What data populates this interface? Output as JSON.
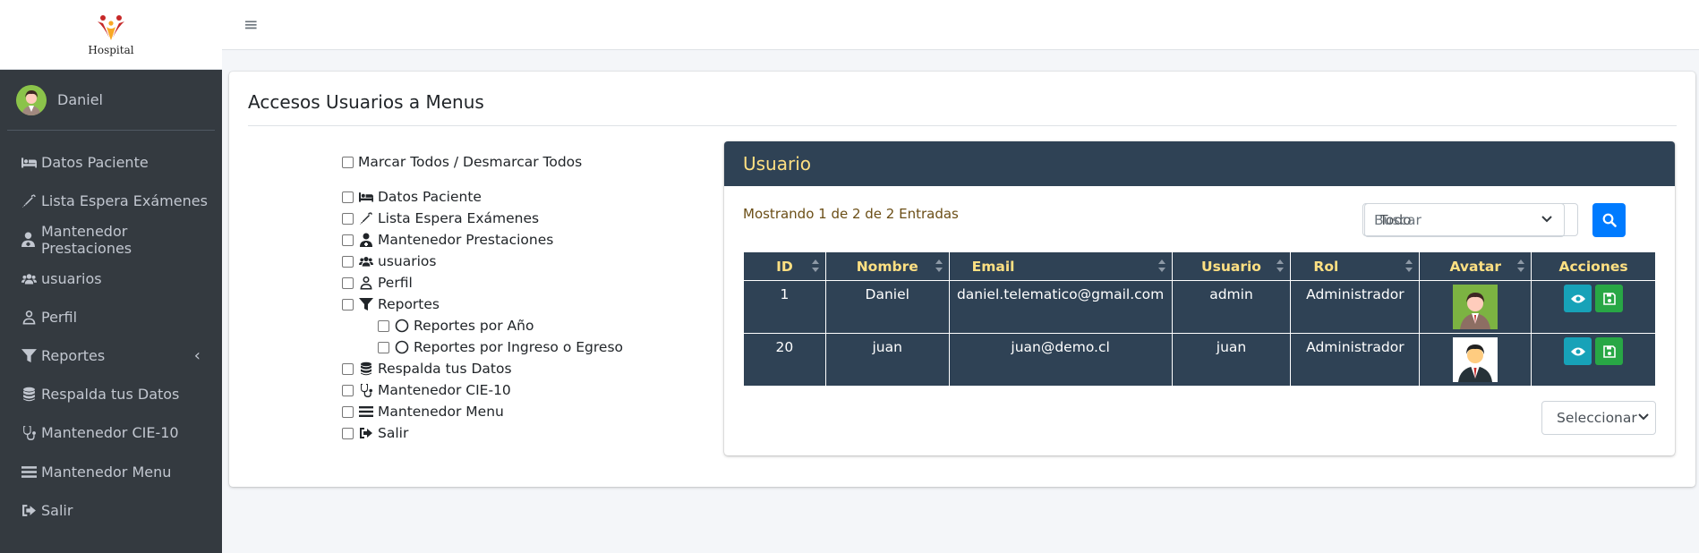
{
  "brand": {
    "name": "Hospital"
  },
  "user": {
    "name": "Daniel"
  },
  "sidebar": {
    "items": [
      {
        "label": "Datos Paciente",
        "icon": "bed-icon"
      },
      {
        "label": "Lista Espera Exámenes",
        "icon": "syringe-icon"
      },
      {
        "label": "Mantenedor Prestaciones",
        "icon": "user-doctor-icon"
      },
      {
        "label": "usuarios",
        "icon": "users-icon"
      },
      {
        "label": "Perfil",
        "icon": "user-icon"
      },
      {
        "label": "Reportes",
        "icon": "filter-icon",
        "has_children": true
      },
      {
        "label": "Respalda tus Datos",
        "icon": "database-icon"
      },
      {
        "label": "Mantenedor CIE-10",
        "icon": "stethoscope-icon"
      },
      {
        "label": "Mantenedor Menu",
        "icon": "bars-icon"
      },
      {
        "label": "Salir",
        "icon": "sign-out-icon"
      }
    ]
  },
  "page": {
    "title": "Accesos Usuarios a Menus"
  },
  "checklist": {
    "toggle_all": "Marcar Todos / Desmarcar Todos",
    "items": [
      {
        "label": "Datos Paciente",
        "icon": "bed-icon"
      },
      {
        "label": "Lista Espera Exámenes",
        "icon": "syringe-icon"
      },
      {
        "label": "Mantenedor Prestaciones",
        "icon": "user-doctor-icon"
      },
      {
        "label": "usuarios",
        "icon": "users-icon"
      },
      {
        "label": "Perfil",
        "icon": "user-icon"
      },
      {
        "label": "Reportes",
        "icon": "filter-icon"
      },
      {
        "label": "Reportes por Año",
        "icon": "circle-icon",
        "child": true
      },
      {
        "label": "Reportes por Ingreso o Egreso",
        "icon": "circle-icon",
        "child": true
      },
      {
        "label": "Respalda tus Datos",
        "icon": "database-icon"
      },
      {
        "label": "Mantenedor CIE-10",
        "icon": "stethoscope-icon"
      },
      {
        "label": "Mantenedor Menu",
        "icon": "bars-icon"
      },
      {
        "label": "Salir",
        "icon": "sign-out-icon"
      }
    ]
  },
  "users_panel": {
    "title": "Usuario",
    "entries_text": "Mostrando 1 de 2 de 2 Entradas",
    "filter_select": "Todo",
    "search_placeholder": "Buscar",
    "pager_select": "Seleccionar",
    "columns": [
      "ID",
      "Nombre",
      "Email",
      "Usuario",
      "Rol",
      "Avatar",
      "Acciones"
    ],
    "rows": [
      {
        "id": "1",
        "nombre": "Daniel",
        "email": "daniel.telematico@gmail.com",
        "usuario": "admin",
        "rol": "Administrador",
        "avatar": "avatar-man-green"
      },
      {
        "id": "20",
        "nombre": "juan",
        "email": "juan@demo.cl",
        "usuario": "juan",
        "rol": "Administrador",
        "avatar": "avatar-man-suit"
      }
    ]
  },
  "colors": {
    "sidebar_bg": "#343a40",
    "panel_header": "#2f4255",
    "header_text": "#ffe082",
    "primary": "#007bff",
    "info": "#17a2b8",
    "success": "#28a745"
  }
}
